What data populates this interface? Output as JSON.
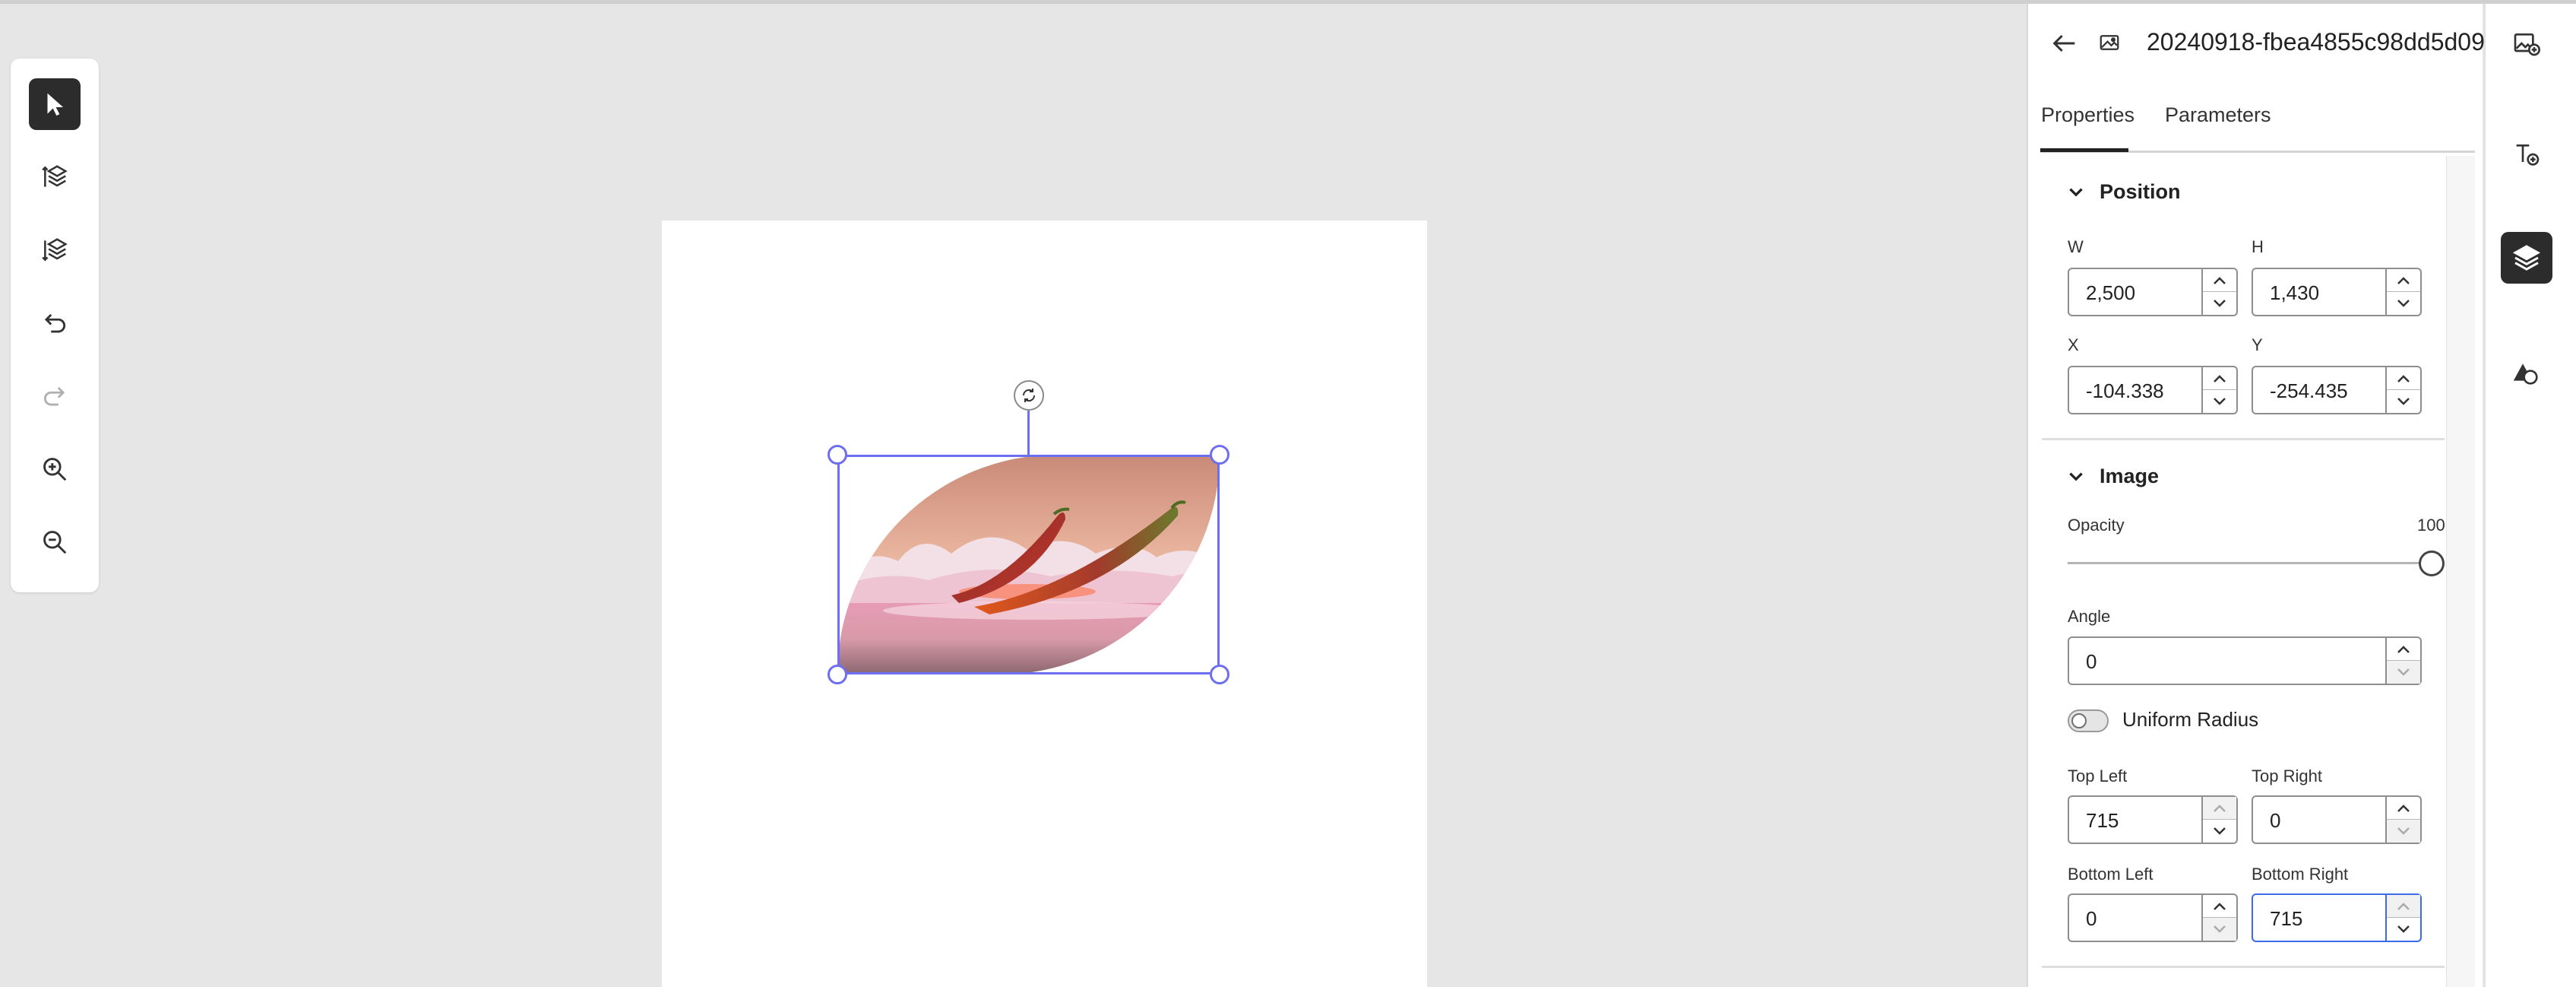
{
  "toolbar": {
    "tools": [
      {
        "name": "select-tool",
        "icon": "pointer-icon",
        "active": true
      },
      {
        "name": "bring-forward-tool",
        "icon": "layers-up-icon"
      },
      {
        "name": "send-backward-tool",
        "icon": "layers-down-icon"
      },
      {
        "name": "undo-tool",
        "icon": "undo-icon"
      },
      {
        "name": "redo-tool",
        "icon": "redo-icon"
      },
      {
        "name": "zoom-in-tool",
        "icon": "zoom-in-icon"
      },
      {
        "name": "zoom-out-tool",
        "icon": "zoom-out-icon"
      }
    ]
  },
  "panel": {
    "title": "20240918-fbea4855c98dd5d09...",
    "tabs": [
      "Properties",
      "Parameters"
    ],
    "active_tab": "Properties",
    "position": {
      "heading": "Position",
      "w_label": "W",
      "w_value": "2,500",
      "h_label": "H",
      "h_value": "1,430",
      "x_label": "X",
      "x_value": "-104.338",
      "y_label": "Y",
      "y_value": "-254.435"
    },
    "image": {
      "heading": "Image",
      "opacity_label": "Opacity",
      "opacity_value": "100",
      "opacity_fraction": 1.0,
      "angle_label": "Angle",
      "angle_value": "0",
      "uniform_radius_label": "Uniform Radius",
      "uniform_radius_on": false,
      "top_left_label": "Top Left",
      "top_left_value": "715",
      "top_right_label": "Top Right",
      "top_right_value": "0",
      "bottom_left_label": "Bottom Left",
      "bottom_left_value": "0",
      "bottom_right_label": "Bottom Right",
      "bottom_right_value": "715"
    }
  },
  "rail": {
    "buttons": [
      {
        "name": "add-image-button",
        "icon": "add-image-icon"
      },
      {
        "name": "add-text-button",
        "icon": "add-text-icon"
      },
      {
        "name": "layers-button",
        "icon": "layers-icon",
        "active": true
      },
      {
        "name": "shapes-button",
        "icon": "shapes-icon"
      }
    ]
  },
  "colors": {
    "selection": "#6e6ef0",
    "focus": "#3b6be8",
    "active_tool": "#2c2c2c",
    "canvas_bg": "#e6e6e6"
  }
}
